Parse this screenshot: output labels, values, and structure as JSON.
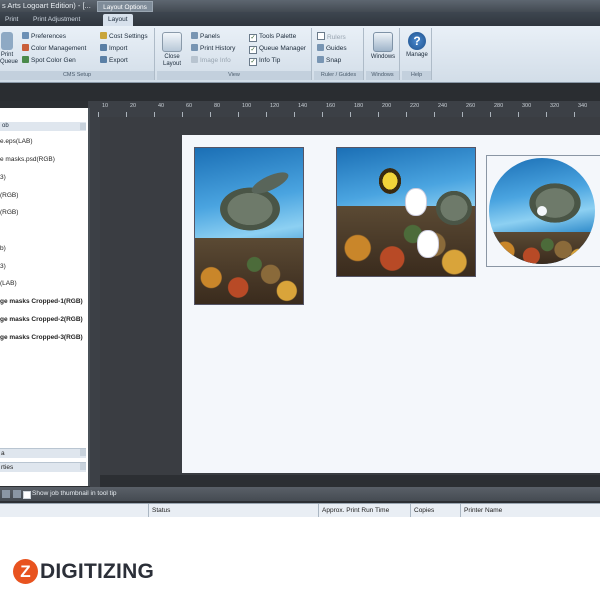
{
  "window": {
    "title": "s Arts Logoart Edition) - [...",
    "contextual_tab": "Layout Options"
  },
  "ribbon_tabs": [
    "Print",
    "Print Adjustment",
    "Layout"
  ],
  "ribbon": {
    "setup_group": {
      "label": "CMS Setup",
      "items": [
        "Preferences",
        "Color Management",
        "Spot Color Gen",
        "Cost Settings",
        "Import",
        "Export"
      ],
      "left_button": "Print\nQueue"
    },
    "view_group": {
      "label": "View",
      "close_layout": "Close\nLayout",
      "items": [
        "Panels",
        "Print History",
        "Image Info",
        "Tools Palette",
        "Queue Manager",
        "Info Tip"
      ]
    },
    "ruler_group": {
      "label": "Ruler / Guides",
      "items": [
        "Rulers",
        "Guides",
        "Snap"
      ]
    },
    "windows_group": {
      "label": "Windows",
      "button": "Windows"
    },
    "help_group": {
      "label": "Help",
      "button": "Manage"
    }
  },
  "left_panel": {
    "header": "ob",
    "items": [
      {
        "text": "e.eps(LAB)",
        "bold": false
      },
      {
        "text": "e masks.psd(RGB)",
        "bold": false
      },
      {
        "text": "3)",
        "bold": false
      },
      {
        "text": "(RGB)",
        "bold": false
      },
      {
        "text": "(RGB)",
        "bold": false
      },
      {
        "text": "b)",
        "bold": false
      },
      {
        "text": "3)",
        "bold": false
      },
      {
        "text": "(LAB)",
        "bold": false
      },
      {
        "text": "ge masks Cropped-1(RGB)",
        "bold": true
      },
      {
        "text": "ge masks Cropped-2(RGB)",
        "bold": true
      },
      {
        "text": "ge masks Cropped-3(RGB)",
        "bold": true
      }
    ],
    "footer_items": [
      "a",
      "rties"
    ]
  },
  "ruler": {
    "labels": [
      "10",
      "20",
      "40",
      "60",
      "80",
      "100",
      "120",
      "140",
      "160",
      "180",
      "200",
      "220",
      "240",
      "260",
      "280",
      "300",
      "320",
      "340"
    ]
  },
  "queue": {
    "checkbox_label": "Show job thumbnail in tool tip",
    "columns": [
      "Status",
      "Approx. Print Run Time",
      "Copies",
      "Printer Name"
    ]
  },
  "logo": {
    "letter": "Z",
    "text": "DIGITIZING"
  },
  "colors": {
    "accent": "#e8531f",
    "ribbon_bg": "#dce6f0",
    "canvas_bg": "#3a3d42"
  }
}
